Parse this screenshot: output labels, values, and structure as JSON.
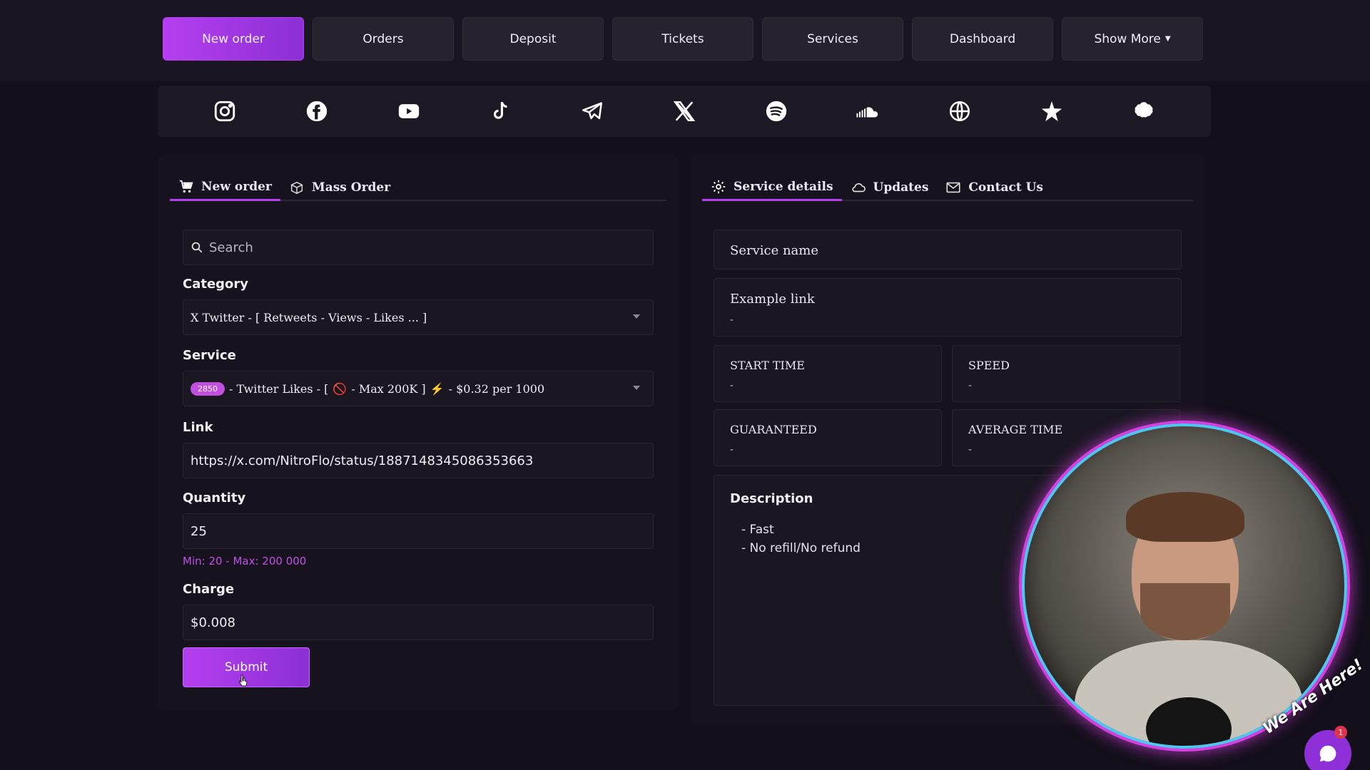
{
  "nav": {
    "items": [
      {
        "label": "New order",
        "active": true
      },
      {
        "label": "Orders"
      },
      {
        "label": "Deposit"
      },
      {
        "label": "Tickets"
      },
      {
        "label": "Services"
      },
      {
        "label": "Dashboard"
      },
      {
        "label": "Show More"
      }
    ]
  },
  "social_icons": [
    "instagram-icon",
    "facebook-icon",
    "youtube-icon",
    "tiktok-icon",
    "telegram-icon",
    "x-twitter-icon",
    "spotify-icon",
    "soundcloud-icon",
    "globe-icon",
    "star-icon",
    "other-icon"
  ],
  "order_panel": {
    "tabs": [
      {
        "label": "New order"
      },
      {
        "label": "Mass Order"
      }
    ],
    "search_placeholder": "Search",
    "category_label": "Category",
    "category_value": "X Twitter - [ Retweets - Views - Likes ... ]",
    "service_label": "Service",
    "service_badge": "2850",
    "service_text_a": "- Twitter Likes - [",
    "service_text_b": "- Max 200K ]",
    "service_text_c": "- $0.32 per 1000",
    "link_label": "Link",
    "link_value": "https://x.com/NitroFlo/status/1887148345086353663",
    "quantity_label": "Quantity",
    "quantity_value": "25",
    "quantity_hint": "Min: 20 - Max: 200 000",
    "charge_label": "Charge",
    "charge_value": "$0.008",
    "submit_label": "Submit"
  },
  "details_panel": {
    "tabs": [
      {
        "label": "Service details"
      },
      {
        "label": "Updates"
      },
      {
        "label": "Contact Us"
      }
    ],
    "service_name_label": "Service name",
    "example_link_label": "Example link",
    "example_link_value": "-",
    "start_time_label": "START TIME",
    "start_time_value": "-",
    "speed_label": "SPEED",
    "speed_value": "-",
    "guaranteed_label": "GUARANTEED",
    "guaranteed_value": "-",
    "average_time_label": "AVERAGE TIME",
    "average_time_value": "-",
    "description_label": "Description",
    "description_lines": [
      "- Fast",
      "- No refill/No refund"
    ]
  },
  "chat": {
    "badge": "We Are Here!",
    "notification_count": "1"
  },
  "colors": {
    "accent": "#b53ff0",
    "background": "#130f1b",
    "panel": "#17131e"
  }
}
